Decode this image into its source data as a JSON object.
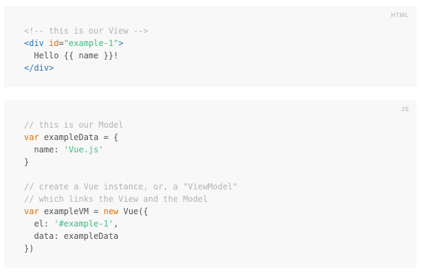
{
  "html_block": {
    "lang": "HTML",
    "comment": "<!-- this is our View -->",
    "open_tag_start": "<div",
    "attr_name": "id",
    "attr_eq": "=",
    "attr_value": "\"example-1\"",
    "open_tag_end": ">",
    "body_text": "  Hello {{ name }}!",
    "close_tag": "</div>"
  },
  "js_block": {
    "lang": "JS",
    "comment1": "// this is our Model",
    "kw_var1": "var",
    "decl1": " exampleData = {",
    "prop_name": "  name: ",
    "prop_value": "'Vue.js'",
    "close1": "}",
    "comment2": "// create a Vue instance, or, a \"ViewModel\"",
    "comment3": "// which links the View and the Model",
    "kw_var2": "var",
    "decl2_a": " exampleVM = ",
    "kw_new": "new",
    "decl2_b": " Vue({",
    "el_name": "  el: ",
    "el_value": "'#example-1'",
    "el_comma": ",",
    "data_line": "  data: exampleData",
    "close2": "})"
  }
}
